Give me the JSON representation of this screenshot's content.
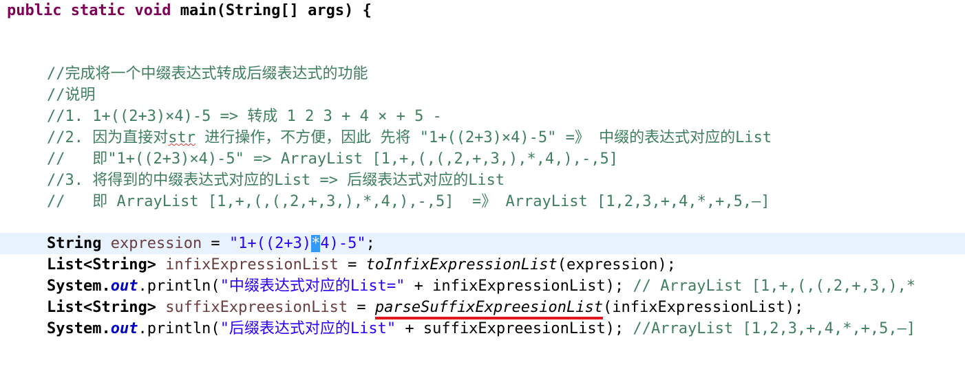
{
  "header": {
    "kw1": "public",
    "kw2": "static",
    "kw3": "void",
    "sig": "main(String[] args) {"
  },
  "comments": [
    "//完成将一个中缀表达式转成后缀表达式的功能",
    "//说明",
    "//1. 1+((2+3)×4)-5 => 转成 1 2 3 + 4 × + 5 -",
    {
      "before": "//2. 因为直接对",
      "squiggle": "str",
      "after": " 进行操作，不方便，因此 先将 \"1+((2+3)×4)-5\" =》 中缀的表达式对应的List"
    },
    "//   即\"1+((2+3)×4)-5\" => ArrayList [1,+,(,(,2,+,3,),*,4,),-,5]",
    "//3. 将得到的中缀表达式对应的List => 后缀表达式对应的List",
    "//   即 ArrayList [1,+,(,(,2,+,3,),*,4,),-,5]  =》 ArrayList [1,2,3,+,4,*,+,5,–]"
  ],
  "code": {
    "l1": {
      "type": "String",
      "var": "expression",
      "eq": " = ",
      "str_a": "\"1+((2+3)",
      "str_sel": "*",
      "str_b": "4)-5\"",
      "end": ";"
    },
    "l2": {
      "type": "List<String>",
      "var": "infixExpressionList",
      "eq": " = ",
      "method": "toInfixExpressionList",
      "args": "(expression);"
    },
    "l3": {
      "sys": "System.",
      "out": "out",
      "println": ".println(",
      "str": "\"中缀表达式对应的List=\"",
      "plus": " + infixExpressionList);",
      "comment": " // ArrayList [1,+,(,(,2,+,3,),*"
    },
    "l4": {
      "type": "List<String>",
      "var": "suffixExpreesionList",
      "eq": " = ",
      "method": "parseSuffixExpreesionList",
      "args": "(infixExpressionList);"
    },
    "l5": {
      "sys": "System.",
      "out": "out",
      "println": ".println(",
      "str": "\"后缀表达式对应的List\"",
      "plus": " + suffixExpreesionList);",
      "comment": " //ArrayList [1,2,3,+,4,*,+,5,–]"
    }
  },
  "colors": {
    "keyword": "#7f0055",
    "comment": "#3f7f5f",
    "string": "#2a00ff",
    "field": "#0000c0",
    "local_var": "#6a3e3e",
    "current_line": "#e8f2fe",
    "selection": "#3399ff",
    "annotation_underline": "#e3171e"
  }
}
